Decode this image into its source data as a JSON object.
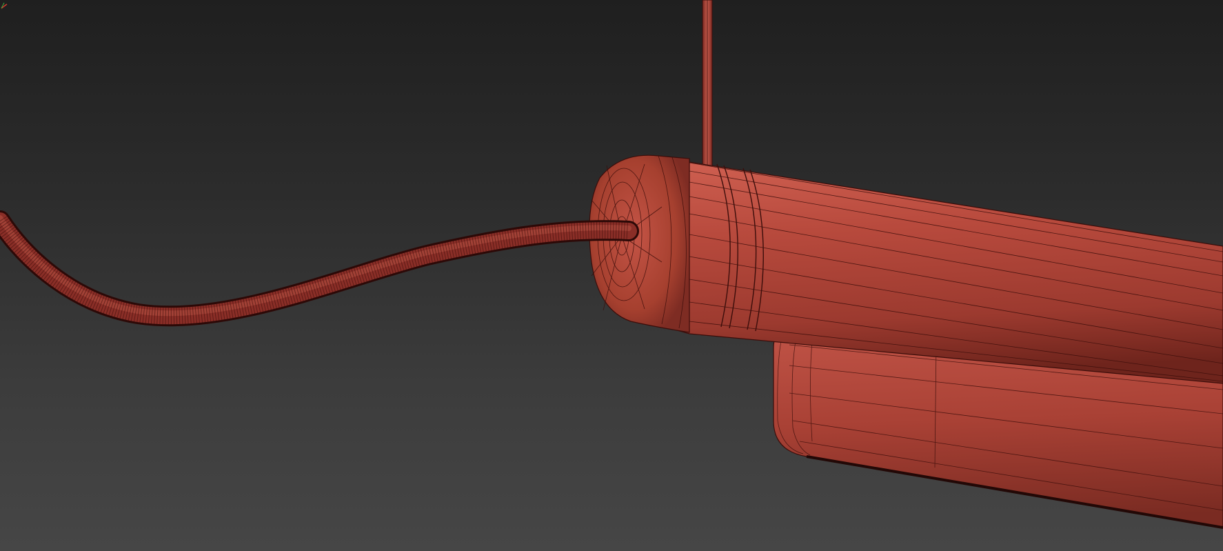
{
  "viewport": {
    "background_top": "#1f1f1f",
    "background_bottom": "#464646",
    "shading_mode": "wireframe-over-shaded",
    "objects": [
      {
        "name": "hanging-rod",
        "color": "#b8473a"
      },
      {
        "name": "power-cable",
        "color": "#8a2e27"
      },
      {
        "name": "tube-body",
        "color": "#c0473b"
      },
      {
        "name": "end-cap",
        "color": "#b2433a"
      },
      {
        "name": "lower-housing",
        "color": "#b0443a"
      }
    ],
    "wire_color": "#3a0d0a",
    "axis_gizmo": {
      "icon": "axis-tripod-icon",
      "x_color": "#d23b2e",
      "y_color": "#3fae3f"
    }
  }
}
